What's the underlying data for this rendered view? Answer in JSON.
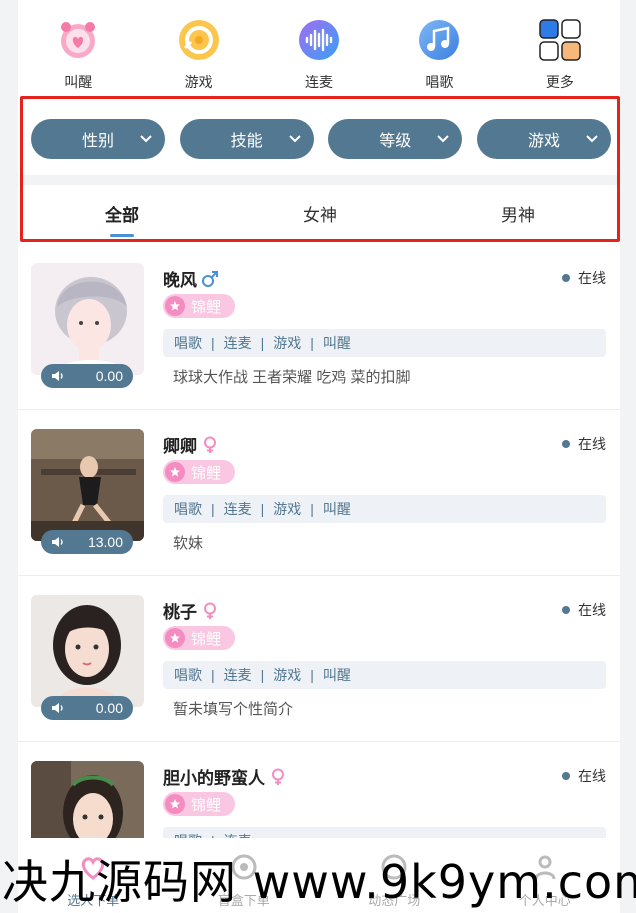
{
  "categories": [
    {
      "label": "叫醒",
      "icon": "alarm-clock-icon",
      "color": "#f47aa8"
    },
    {
      "label": "游戏",
      "icon": "game-disc-icon",
      "color": "#f7a822"
    },
    {
      "label": "连麦",
      "icon": "sound-wave-icon",
      "color": "#4f8df2"
    },
    {
      "label": "唱歌",
      "icon": "music-note-icon",
      "color": "#5a9df0"
    },
    {
      "label": "更多",
      "icon": "grid-more-icon",
      "color": "#2f7be5"
    }
  ],
  "filters": [
    "性别",
    "技能",
    "等级",
    "游戏"
  ],
  "tabs": [
    {
      "label": "全部",
      "active": true
    },
    {
      "label": "女神",
      "active": false
    },
    {
      "label": "男神",
      "active": false
    }
  ],
  "status_label": "在线",
  "badge_label": "锦鲤",
  "tag_labels": [
    "唱歌",
    "连麦",
    "游戏",
    "叫醒"
  ],
  "users": [
    {
      "name": "晚风",
      "gender": "male",
      "voice": "0.00",
      "bio": "球球大作战 王者荣耀 吃鸡 菜的扣脚"
    },
    {
      "name": "卿卿",
      "gender": "female",
      "voice": "13.00",
      "bio": "软妹"
    },
    {
      "name": "桃子",
      "gender": "female",
      "voice": "0.00",
      "bio": "暂未填写个性简介"
    },
    {
      "name": "胆小的野蛮人",
      "gender": "female",
      "voice": "",
      "bio": ""
    }
  ],
  "bottom_nav": [
    {
      "label": "选人下单",
      "icon": "heart-icon",
      "active": true
    },
    {
      "label": "盲盒下单",
      "icon": "blind-box-icon",
      "active": false
    },
    {
      "label": "动态广场",
      "icon": "square-icon",
      "active": false
    },
    {
      "label": "个人中心",
      "icon": "person-icon",
      "active": false
    }
  ],
  "watermark": "决九源码网 www.9k9ym.com",
  "colors": {
    "accent": "#537891",
    "highlight_border": "#e5231d",
    "badge": "#f9c7e2",
    "female": "#f48cc2",
    "male": "#4a90d9"
  }
}
